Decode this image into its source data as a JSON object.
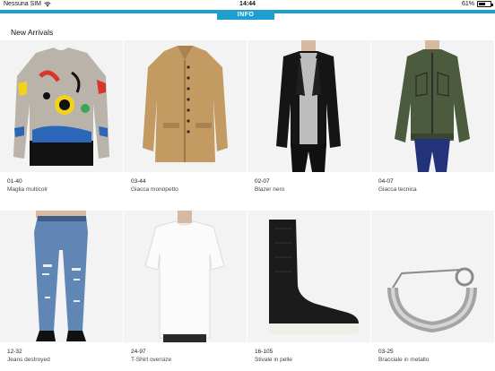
{
  "status": {
    "carrier": "Nessuna SIM",
    "time": "14:44",
    "battery": "61%",
    "battery_level": 0.61
  },
  "tab": {
    "label": "INFO"
  },
  "page": {
    "title": "New Arrivals"
  },
  "products": [
    {
      "code": "01-40",
      "name": "Maglia multicolr",
      "icon": "sweater-image"
    },
    {
      "code": "03-44",
      "name": "Giacca monopetto",
      "icon": "jacket-image"
    },
    {
      "code": "02-07",
      "name": "Blazer nero",
      "icon": "blazer-image"
    },
    {
      "code": "04-07",
      "name": "Giacca tecnica",
      "icon": "technical-jacket-image"
    },
    {
      "code": "12-32",
      "name": "Jeans destroyed",
      "icon": "jeans-image"
    },
    {
      "code": "24-97",
      "name": "T-Shirt oversize",
      "icon": "tshirt-image"
    },
    {
      "code": "16-105",
      "name": "Stivale in pelle",
      "icon": "boot-image"
    },
    {
      "code": "03-25",
      "name": "Bracciale in metallo",
      "icon": "bracelet-image"
    }
  ],
  "colors": {
    "accent": "#1e9fcf",
    "tile_background": "#f3f3f3"
  }
}
